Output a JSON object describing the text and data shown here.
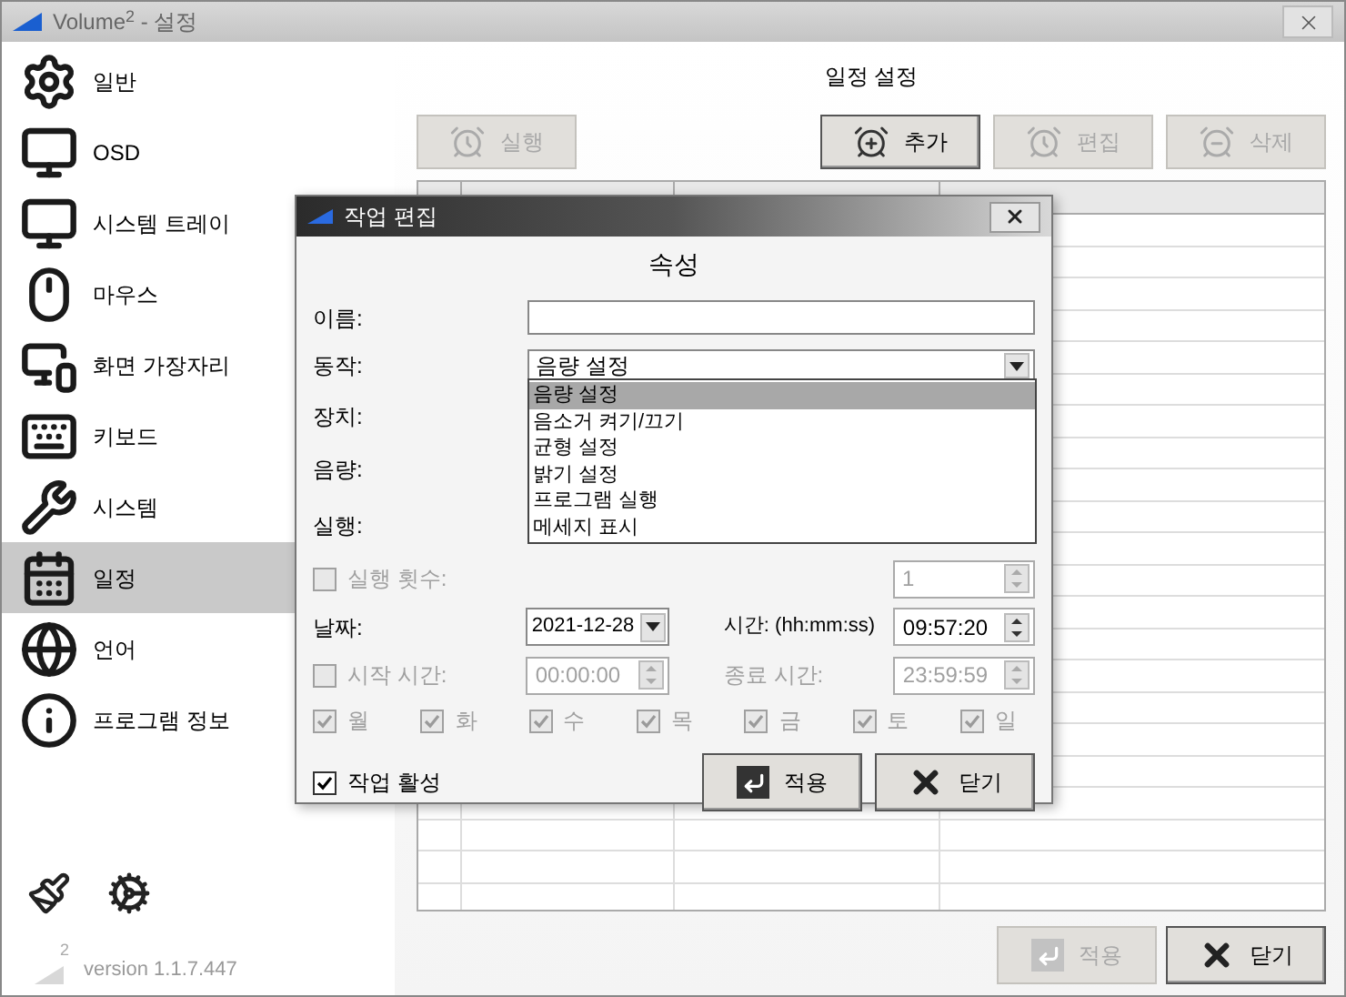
{
  "window": {
    "title": "Volume$^{2}$ - 설정"
  },
  "sidebar": {
    "items": [
      {
        "label": "일반",
        "selected": false
      },
      {
        "label": "OSD",
        "selected": false
      },
      {
        "label": "시스템 트레이",
        "selected": false
      },
      {
        "label": "마우스",
        "selected": false
      },
      {
        "label": "화면 가장자리",
        "selected": false
      },
      {
        "label": "키보드",
        "selected": false
      },
      {
        "label": "시스템",
        "selected": false
      },
      {
        "label": "일정",
        "selected": true
      },
      {
        "label": "언어",
        "selected": false
      },
      {
        "label": "프로그램 정보",
        "selected": false
      }
    ]
  },
  "schedule": {
    "title": "일정 설정",
    "buttons": [
      {
        "label": "실행",
        "disabled": true
      },
      {
        "label": "추가",
        "disabled": false
      },
      {
        "label": "편집",
        "disabled": true
      },
      {
        "label": "삭제",
        "disabled": true
      }
    ]
  },
  "dialog": {
    "title": "작업 편집",
    "section": "속성",
    "labels": [
      "이름:",
      "동작:",
      "장치:",
      "음량:",
      "실행:"
    ],
    "action_value": "음량 설정",
    "options": [
      {
        "label": "음량 설정",
        "selected": true
      },
      {
        "label": "음소거 켜기/끄기",
        "selected": false
      },
      {
        "label": "균형 설정",
        "selected": false
      },
      {
        "label": "밝기 설정",
        "selected": false
      },
      {
        "label": "프로그램 실행",
        "selected": false
      },
      {
        "label": "메세지 표시",
        "selected": false
      }
    ],
    "repeat": {
      "label": "실행 횟수:",
      "checked": false,
      "disabled": true,
      "value": "1"
    },
    "date": {
      "label": "날짜:",
      "value": "2021-12-28"
    },
    "time": {
      "label": "시간: (hh:mm:ss)",
      "value": "09:57:20"
    },
    "start": {
      "label": "시작 시간:",
      "checked": false,
      "disabled": true,
      "value": "00:00:00"
    },
    "end": {
      "label": "종료 시간:",
      "value": "23:59:59"
    },
    "days": [
      {
        "label": "월",
        "checked": true,
        "disabled": true
      },
      {
        "label": "화",
        "checked": true,
        "disabled": true
      },
      {
        "label": "수",
        "checked": true,
        "disabled": true
      },
      {
        "label": "목",
        "checked": true,
        "disabled": true
      },
      {
        "label": "금",
        "checked": true,
        "disabled": true
      },
      {
        "label": "토",
        "checked": true,
        "disabled": true
      },
      {
        "label": "일",
        "checked": true,
        "disabled": true
      }
    ],
    "active": {
      "label": "작업 활성",
      "checked": true,
      "disabled": false
    },
    "buttons": [
      {
        "label": "적용",
        "disabled": false
      },
      {
        "label": "닫기",
        "disabled": false
      }
    ]
  },
  "footer": {
    "logo_mark": "2",
    "version": "version 1.1.7.447",
    "buttons": [
      {
        "label": "적용",
        "disabled": true
      },
      {
        "label": "닫기",
        "disabled": false
      }
    ]
  }
}
